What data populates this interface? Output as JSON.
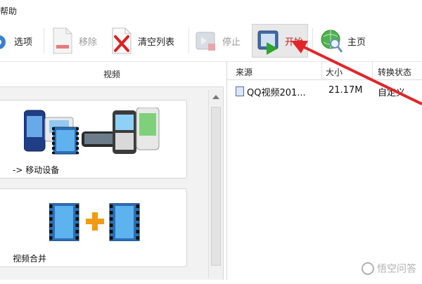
{
  "menubar": {
    "help_partial": "帮助"
  },
  "toolbar": {
    "options_label": "选项",
    "remove_label": "移除",
    "clear_list_label": "清空列表",
    "stop_label": "停止",
    "start_label": "开始",
    "home_label": "主页"
  },
  "left_panel": {
    "header": "视频",
    "cards": [
      {
        "label": "-> 移动设备",
        "icon": "mobile-devices-icon"
      },
      {
        "label": "视频合并",
        "icon": "video-merge-icon"
      }
    ]
  },
  "table": {
    "columns": [
      "来源",
      "大小",
      "转换状态"
    ],
    "rows": [
      {
        "source": "QQ视频201...",
        "size": "21.17M",
        "status": "自定义"
      }
    ]
  },
  "annotation": {
    "arrow_color": "#e0262b"
  },
  "watermark": {
    "text": "悟空问答"
  }
}
